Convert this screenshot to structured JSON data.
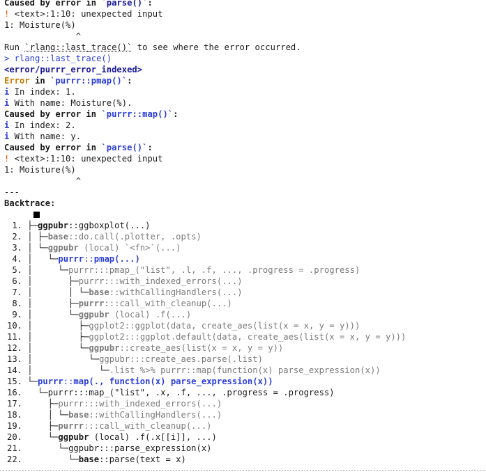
{
  "console": {
    "l1_caused": "Caused by error in ",
    "l1_fn": "`parse()`",
    "l1_colon": ":",
    "l2_bang": "!",
    "l2_text": " <text>:1:10: unexpected input",
    "l3": "1: Moisture(%)",
    "l4": "              ^",
    "l5_run": "Run ",
    "l5_cmd": "`rlang::last_trace()`",
    "l5_rest": " to see where the error occurred.",
    "l6": "> rlang::last_trace()",
    "l7": "<error/purrr_error_indexed>",
    "l8_error": "Error",
    "l8_in": " in ",
    "l8_fn": "`purrr::pmap()`",
    "l8_colon": ":",
    "l9_i": "i",
    "l9_text": " In index: 1.",
    "l10_i": "i",
    "l10_text": " With name: Moisture(%).",
    "l11_caused": "Caused by error in ",
    "l11_fn": "`purrr::map()`",
    "l11_colon": ":",
    "l12_i": "i",
    "l12_text": " In index: 2.",
    "l13_i": "i",
    "l13_text": " With name: y.",
    "l14_caused": "Caused by error in ",
    "l14_fn": "`parse()`",
    "l14_colon": ":",
    "l15_bang": "!",
    "l15_text": " <text>:1:10: unexpected input",
    "l16": "1: Moisture(%)",
    "l17": "              ^",
    "l18": "---",
    "l19": "Backtrace:"
  },
  "backtrace": [
    {
      "n": " 1. ",
      "tree": "├─",
      "pkg": "ggpubr",
      "sep": "::",
      "call": "ggboxplot(...)",
      "style": "bold"
    },
    {
      "n": " 2. ",
      "tree": "│ ├─",
      "pkg": "base",
      "sep": "::",
      "call": "do.call(.plotter, .opts)",
      "style": "greycall"
    },
    {
      "n": " 3. ",
      "tree": "│ └─",
      "pkg": "ggpubr",
      "sep": " (local) ",
      "call": "`<fn>`(...)",
      "style": "greycall"
    },
    {
      "n": " 4. ",
      "tree": "│   └─",
      "pkg": "purrr",
      "sep": "::",
      "call": "pmap(...)",
      "style": "blue"
    },
    {
      "n": " 5. ",
      "tree": "│     └─",
      "pkg": "purrr",
      "sep": ":::",
      "call": "pmap_(\"list\", .l, .f, ..., .progress = .progress)",
      "style": "grey"
    },
    {
      "n": " 6. ",
      "tree": "│       ├─",
      "pkg": "purrr",
      "sep": ":::",
      "call": "with_indexed_errors(...)",
      "style": "grey"
    },
    {
      "n": " 7. ",
      "tree": "│       │ └─",
      "pkg": "base",
      "sep": "::",
      "call": "withCallingHandlers(...)",
      "style": "greycall"
    },
    {
      "n": " 8. ",
      "tree": "│       ├─",
      "pkg": "purrr",
      "sep": ":::",
      "call": "call_with_cleanup(...)",
      "style": "greycall"
    },
    {
      "n": " 9. ",
      "tree": "│       └─",
      "pkg": "ggpubr",
      "sep": " (local) ",
      "call": ".f(...)",
      "style": "greycall"
    },
    {
      "n": "10. ",
      "tree": "│         ├─",
      "pkg": "ggplot2",
      "sep": "::",
      "call": "ggplot(data, create_aes(list(x = x, y = y)))",
      "style": "grey"
    },
    {
      "n": "11. ",
      "tree": "│         ├─",
      "pkg": "ggplot2",
      "sep": ":::",
      "call": "ggplot.default(data, create_aes(list(x = x, y = y)))",
      "style": "grey"
    },
    {
      "n": "12. ",
      "tree": "│         └─",
      "pkg": "ggpubr",
      "sep": "::",
      "call": "create_aes(list(x = x, y = y))",
      "style": "greycall"
    },
    {
      "n": "13. ",
      "tree": "│           └─",
      "pkg": "ggpubr",
      "sep": ":::",
      "call": "create_aes.parse(.list)",
      "style": "grey"
    },
    {
      "n": "14. ",
      "tree": "│             └─",
      "pkg": "",
      "sep": "",
      "call": ".list %>% purrr::map(function(x) parse_expression(x))",
      "style": "grey"
    },
    {
      "n": "15. ",
      "tree": "└─",
      "pkg": "purrr",
      "sep": "::",
      "call": "map(., function(x) parse_expression(x))",
      "style": "blue"
    },
    {
      "n": "16. ",
      "tree": "  └─",
      "pkg": "purrr",
      "sep": ":::",
      "call": "map_(\"list\", .x, .f, ..., .progress = .progress)",
      "style": "plain"
    },
    {
      "n": "17. ",
      "tree": "    ├─",
      "pkg": "purrr",
      "sep": ":::",
      "call": "with_indexed_errors(...)",
      "style": "grey"
    },
    {
      "n": "18. ",
      "tree": "    │ └─",
      "pkg": "base",
      "sep": "::",
      "call": "withCallingHandlers(...)",
      "style": "greycall"
    },
    {
      "n": "19. ",
      "tree": "    ├─",
      "pkg": "purrr",
      "sep": ":::",
      "call": "call_with_cleanup(...)",
      "style": "greycall"
    },
    {
      "n": "20. ",
      "tree": "    └─",
      "pkg": "ggpubr",
      "sep": " (local) ",
      "call": ".f(.x[[i]], ...)",
      "style": "bold"
    },
    {
      "n": "21. ",
      "tree": "      └─",
      "pkg": "ggpubr",
      "sep": ":::",
      "call": "parse_expression(x)",
      "style": "plain"
    },
    {
      "n": "22. ",
      "tree": "        └─",
      "pkg": "base",
      "sep": "::",
      "call": "parse(text = x)",
      "style": "bold"
    }
  ]
}
